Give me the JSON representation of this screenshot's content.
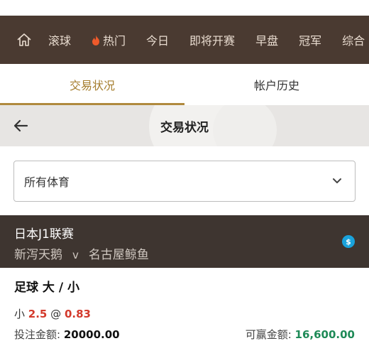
{
  "nav": {
    "items": [
      "滚球",
      "热门",
      "今日",
      "即将开赛",
      "早盘",
      "冠军",
      "综合"
    ]
  },
  "tabs": [
    "交易状况",
    "帐户历史"
  ],
  "header": {
    "title": "交易状况"
  },
  "filter": {
    "selected": "所有体育"
  },
  "match": {
    "league": "日本J1联赛",
    "home": "新泻天鹅",
    "vs": "v",
    "away": "名古屋鲸鱼",
    "badge": "$"
  },
  "bet": {
    "market": "足球 大 / 小",
    "selection_prefix": "小",
    "line": "2.5",
    "at": "@",
    "odds": "0.83",
    "stake_label": "投注金额:",
    "stake_value": "20000.00",
    "win_label": "可赢金额:",
    "win_value": "16,600.00"
  },
  "colors": {
    "nav_bg": "#4a3a31",
    "accent_gold": "#b08a3e",
    "match_bg": "#3e3530",
    "odds_red": "#d33a2c",
    "win_green": "#1e8a57",
    "badge_blue": "#1aa3dc"
  }
}
